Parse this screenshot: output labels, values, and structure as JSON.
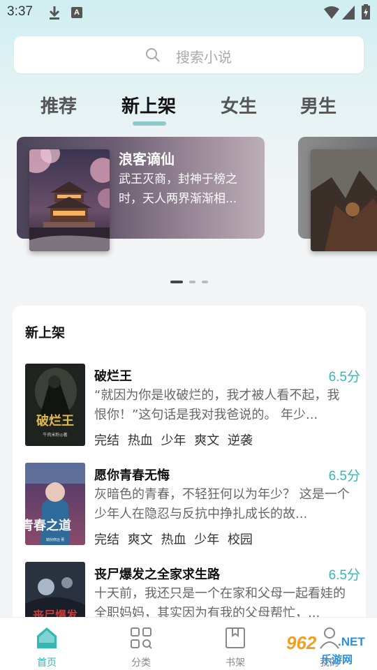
{
  "status_bar": {
    "time": "3:37",
    "notification_letter": "A"
  },
  "search": {
    "placeholder": "搜索小说"
  },
  "tabs": [
    {
      "label": "推荐",
      "active": false
    },
    {
      "label": "新上架",
      "active": true
    },
    {
      "label": "女生",
      "active": false
    },
    {
      "label": "男生",
      "active": false
    }
  ],
  "banner": {
    "title": "浪客谪仙",
    "description": "武王灭商，封神于榜之时，天人两界渐渐相...",
    "page_count": 3,
    "current_page": 1
  },
  "section": {
    "title": "新上架",
    "books": [
      {
        "name": "破烂王",
        "score": "6.5分",
        "description": "“就因为你是收破烂的，我才被人看不起，我恨你！”这句话是我对我爸说的。 年少...",
        "tags": [
          "完结",
          "热血",
          "少年",
          "爽文",
          "逆袭"
        ],
        "cover_title": "破烂王",
        "cover_author": "牛肉米粉◎著"
      },
      {
        "name": "愿你青春无悔",
        "score": "6.5分",
        "description": "灰暗色的青春，不轻狂何以为年少？ 这是一个少年人在隐忍与反抗中挣扎成长的故...",
        "tags": [
          "完结",
          "爽文",
          "热血",
          "少年",
          "校园"
        ],
        "cover_title": "青春之道",
        "cover_author": "端倪修远 著"
      },
      {
        "name": "丧尸爆发之全家求生路",
        "score": "6.5分",
        "description": "十天前，我还只是一个在家和父母一起看娃的全职妈妈，其实因为有我的父母帮忙，...",
        "tags": [],
        "cover_title": "丧尸爆发",
        "cover_author": ""
      }
    ]
  },
  "bottom_nav": [
    {
      "label": "首页",
      "icon": "home-icon",
      "active": true
    },
    {
      "label": "分类",
      "icon": "category-icon",
      "active": false
    },
    {
      "label": "书架",
      "icon": "bookshelf-icon",
      "active": false
    },
    {
      "label": "我的",
      "icon": "profile-icon",
      "active": false
    }
  ],
  "watermark": {
    "number": "962",
    "domain": ".NET",
    "name": "乐游网"
  },
  "colors": {
    "accent": "#36b7b5",
    "tab_indicator": "#8ec9c9"
  }
}
